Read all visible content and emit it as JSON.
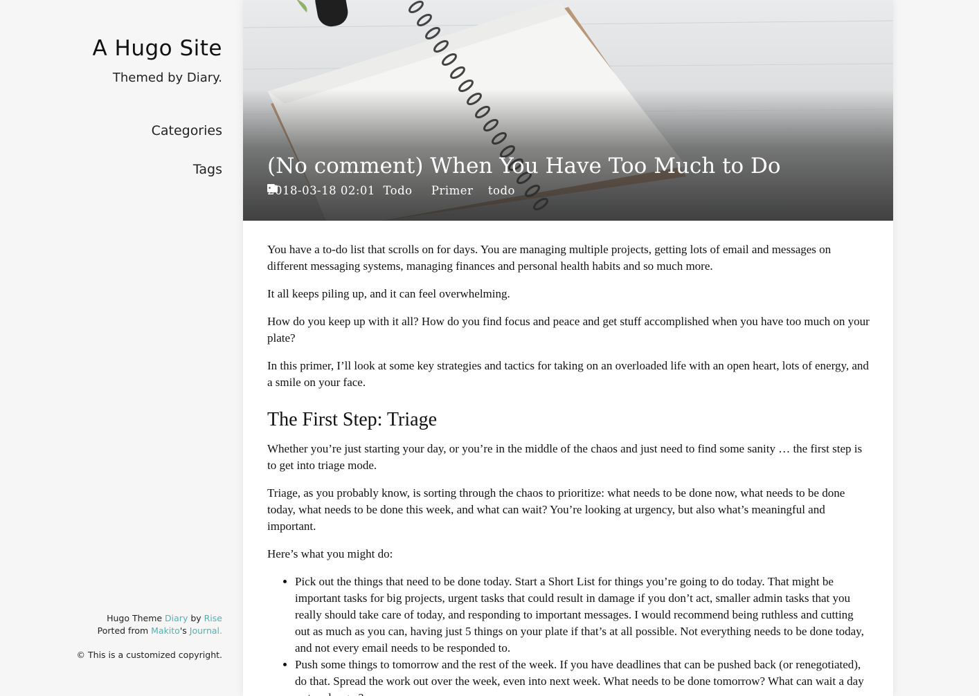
{
  "sidebar": {
    "site_title": "A Hugo Site",
    "subtitle": "Themed by Diary.",
    "nav": [
      {
        "label": "Categories"
      },
      {
        "label": "Tags"
      }
    ],
    "footer": {
      "line1_prefix": "Hugo Theme ",
      "theme_link": "Diary",
      "line1_by": " by ",
      "author_link": "Rise",
      "line2_prefix": "Ported from ",
      "source_author_link": "Makito",
      "line2_possessive": "'s ",
      "source_link": "Journal.",
      "copyright": "© This is a customized copyright."
    },
    "link_color": "#4fb3b0"
  },
  "post": {
    "title": "(No comment) When You Have Too Much to Do",
    "date": "2018-03-18 02:01",
    "category": "Todo",
    "tags": [
      "Primer",
      "todo"
    ],
    "category_icon": "folder-icon",
    "tag_icon": "tag-icon",
    "paragraphs_intro": [
      "You have a to-do list that scrolls on for days. You are managing multiple projects, getting lots of email and messages on different messaging systems, managing finances and personal health habits and so much more.",
      "It all keeps piling up, and it can feel overwhelming.",
      "How do you keep up with it all? How do you find focus and peace and get stuff accomplished when you have too much on your plate?",
      "In this primer, I’ll look at some key strategies and tactics for taking on an overloaded life with an open heart, lots of energy, and a smile on your face."
    ],
    "heading1": "The First Step: Triage",
    "paragraphs_triage": [
      "Whether you’re just starting your day, or you’re in the middle of the chaos and just need to find some sanity … the first step is to get into triage mode.",
      "Triage, as you probably know, is sorting through the chaos to prioritize: what needs to be done now, what needs to be done today, what needs to be done this week, and what can wait? You’re looking at urgency, but also what’s meaningful and important.",
      "Here’s what you might do:"
    ],
    "list": [
      "Pick out the things that need to be done today. Start a Short List for things you’re going to do today. That might be important tasks for big projects, urgent tasks that could result in damage if you don’t act, smaller admin tasks that you really should take care of today, and responding to important messages. I would recommend being ruthless and cutting out as much as you can, having just 5 things on your plate if that’s at all possible. Not everything needs to be done today, and not every email needs to be responded to.",
      "Push some things to tomorrow and the rest of the week. If you have deadlines that can be pushed back (or renegotiated), do that. Spread the work out over the week, even into next week. What needs to be done tomorrow? What can wait a day or two longer?"
    ]
  }
}
